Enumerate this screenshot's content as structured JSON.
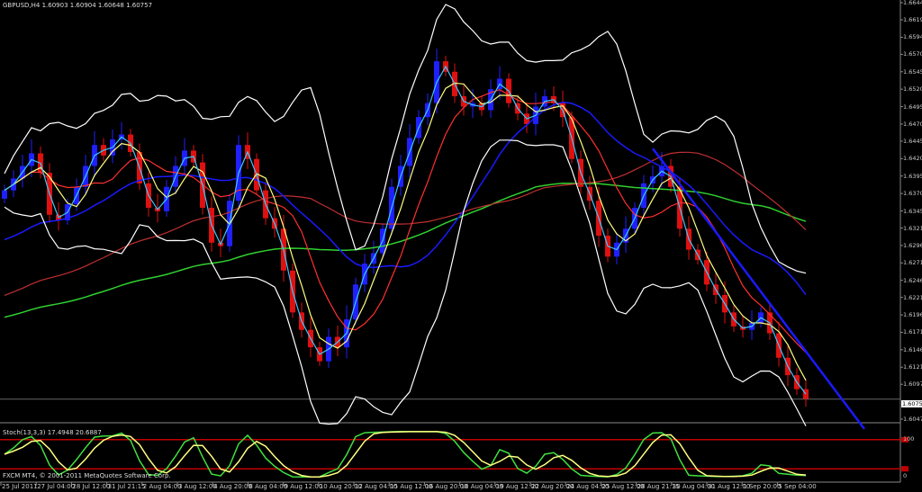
{
  "header": {
    "title": "GBPUSD,H4  1.60903 1.60904 1.60648 1.60757"
  },
  "stoch": {
    "title": "Stoch(13,3,3) 17.4948 20.6887",
    "axis_top": "100",
    "axis_bottom": "0"
  },
  "footer": {
    "copyright": "FXCM MT4, © 2001-2011 MetaQuotes Software Corp."
  },
  "colors": {
    "bull": "#2020ff",
    "bear": "#e01010",
    "bands": "#ffffff",
    "ma_fast": "#3cc8ff",
    "ma_med": "#ffff80",
    "ma_slow": "#ff3030",
    "ma_long_red": "#c03030",
    "ma_long_green": "#30d030",
    "ma_blue": "#1a1aff",
    "stoch_main": "#40e040",
    "stoch_signal": "#ffff80",
    "levels": "#c00000"
  },
  "chart_data": {
    "type": "candlestick",
    "symbol": "GBPUSD",
    "timeframe": "H4",
    "ylim": [
      1.6047,
      1.6644
    ],
    "current_price": "1.60757",
    "price_ticks": [
      "1.66440",
      "1.66195",
      "1.65945",
      "1.65700",
      "1.65450",
      "1.65200",
      "1.64950",
      "1.64700",
      "1.64455",
      "1.64205",
      "1.63955",
      "1.63705",
      "1.63455",
      "1.63210",
      "1.62960",
      "1.62710",
      "1.62460",
      "1.62215",
      "1.61965",
      "1.61715",
      "1.61465",
      "1.61215",
      "1.60970",
      "1.60470"
    ],
    "time_ticks": [
      "25 Jul 2011",
      "27 Jul 04:00",
      "28 Jul 12:00",
      "31 Jul 21:15",
      "2 Aug 04:00",
      "3 Aug 12:00",
      "4 Aug 20:00",
      "8 Aug 04:00",
      "9 Aug 12:00",
      "10 Aug 20:00",
      "12 Aug 04:00",
      "15 Aug 12:00",
      "16 Aug 20:00",
      "18 Aug 04:00",
      "19 Aug 12:00",
      "22 Aug 20:00",
      "24 Aug 04:00",
      "25 Aug 12:00",
      "28 Aug 21:15",
      "30 Aug 04:00",
      "31 Aug 12:00",
      "1 Sep 20:00",
      "5 Sep 04:00"
    ],
    "closes": [
      1.6375,
      1.6392,
      1.641,
      1.6428,
      1.64,
      1.634,
      1.6332,
      1.6355,
      1.638,
      1.641,
      1.644,
      1.6425,
      1.6448,
      1.6455,
      1.643,
      1.6385,
      1.635,
      1.6345,
      1.638,
      1.641,
      1.6432,
      1.6415,
      1.635,
      1.63,
      1.6295,
      1.636,
      1.644,
      1.642,
      1.6375,
      1.6335,
      1.632,
      1.626,
      1.62,
      1.6175,
      1.615,
      1.613,
      1.6165,
      1.615,
      1.619,
      1.624,
      1.627,
      1.6285,
      1.632,
      1.638,
      1.641,
      1.645,
      1.648,
      1.65,
      1.656,
      1.6545,
      1.651,
      1.6495,
      1.65,
      1.649,
      1.652,
      1.6535,
      1.65,
      1.6485,
      1.647,
      1.6495,
      1.651,
      1.65,
      1.648,
      1.642,
      1.638,
      1.636,
      1.631,
      1.628,
      1.63,
      1.632,
      1.635,
      1.6385,
      1.6395,
      1.641,
      1.638,
      1.632,
      1.629,
      1.6275,
      1.624,
      1.6225,
      1.62,
      1.618,
      1.6175,
      1.6185,
      1.62,
      1.617,
      1.6135,
      1.611,
      1.609,
      1.6076
    ],
    "trendline": {
      "from": {
        "index": 72,
        "price": 1.6435
      },
      "to": {
        "index": 95.5,
        "price": 1.6033
      }
    },
    "stoch_levels": [
      80,
      20
    ],
    "indicators": [
      "SMA 5",
      "SMA 10",
      "SMA 21",
      "Bollinger 20,2",
      "SMA 50",
      "SMA 100",
      "SMA 200"
    ]
  }
}
